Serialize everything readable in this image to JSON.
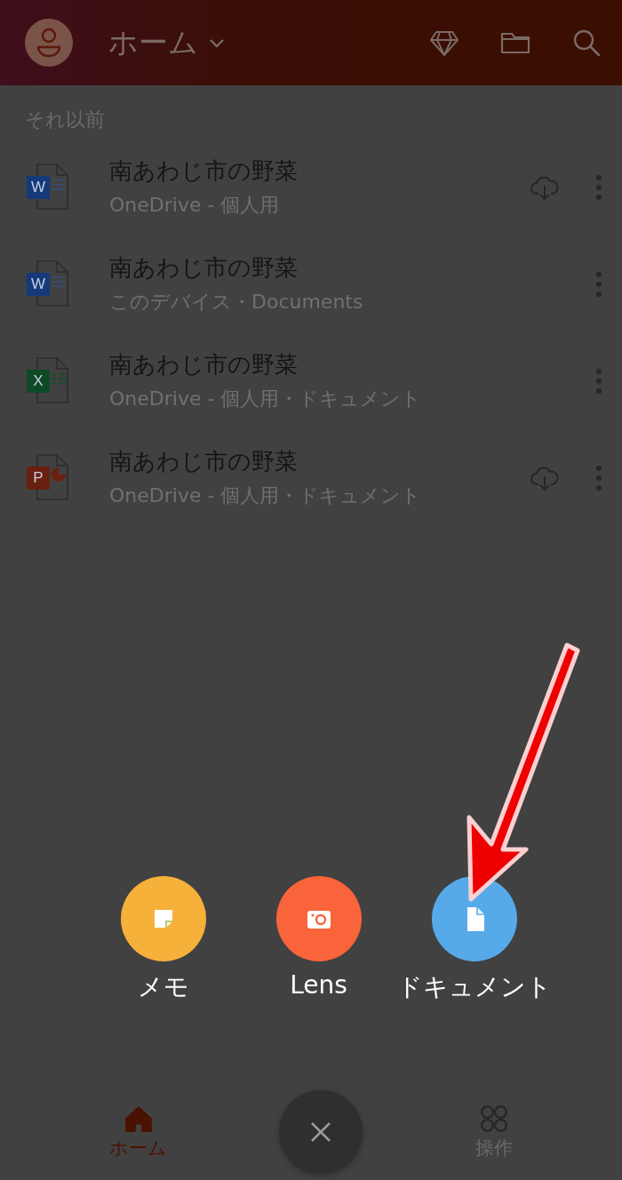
{
  "header": {
    "title": "ホーム"
  },
  "section_label": "それ以前",
  "files": [
    {
      "kind": "word",
      "app_letter": "W",
      "name": "南あわじ市の野菜",
      "location": "OneDrive - 個人用",
      "cloud_download": true
    },
    {
      "kind": "word",
      "app_letter": "W",
      "name": "南あわじ市の野菜",
      "location": "このデバイス・Documents",
      "cloud_download": false
    },
    {
      "kind": "excel",
      "app_letter": "X",
      "name": "南あわじ市の野菜",
      "location": "OneDrive - 個人用・ドキュメント",
      "cloud_download": false
    },
    {
      "kind": "powerpoint",
      "app_letter": "P",
      "name": "南あわじ市の野菜",
      "location": "OneDrive - 個人用・ドキュメント",
      "cloud_download": true
    }
  ],
  "create_actions": [
    {
      "kind": "note",
      "label": "メモ",
      "color": "#f6b13a"
    },
    {
      "kind": "lens",
      "label": "Lens",
      "color": "#f9643a"
    },
    {
      "kind": "document",
      "label": "ドキュメント",
      "color": "#56aae9"
    }
  ],
  "bottom_nav": [
    {
      "kind": "home",
      "label": "ホーム",
      "selected": true
    },
    {
      "kind": "actions",
      "label": "操作",
      "selected": false
    }
  ]
}
